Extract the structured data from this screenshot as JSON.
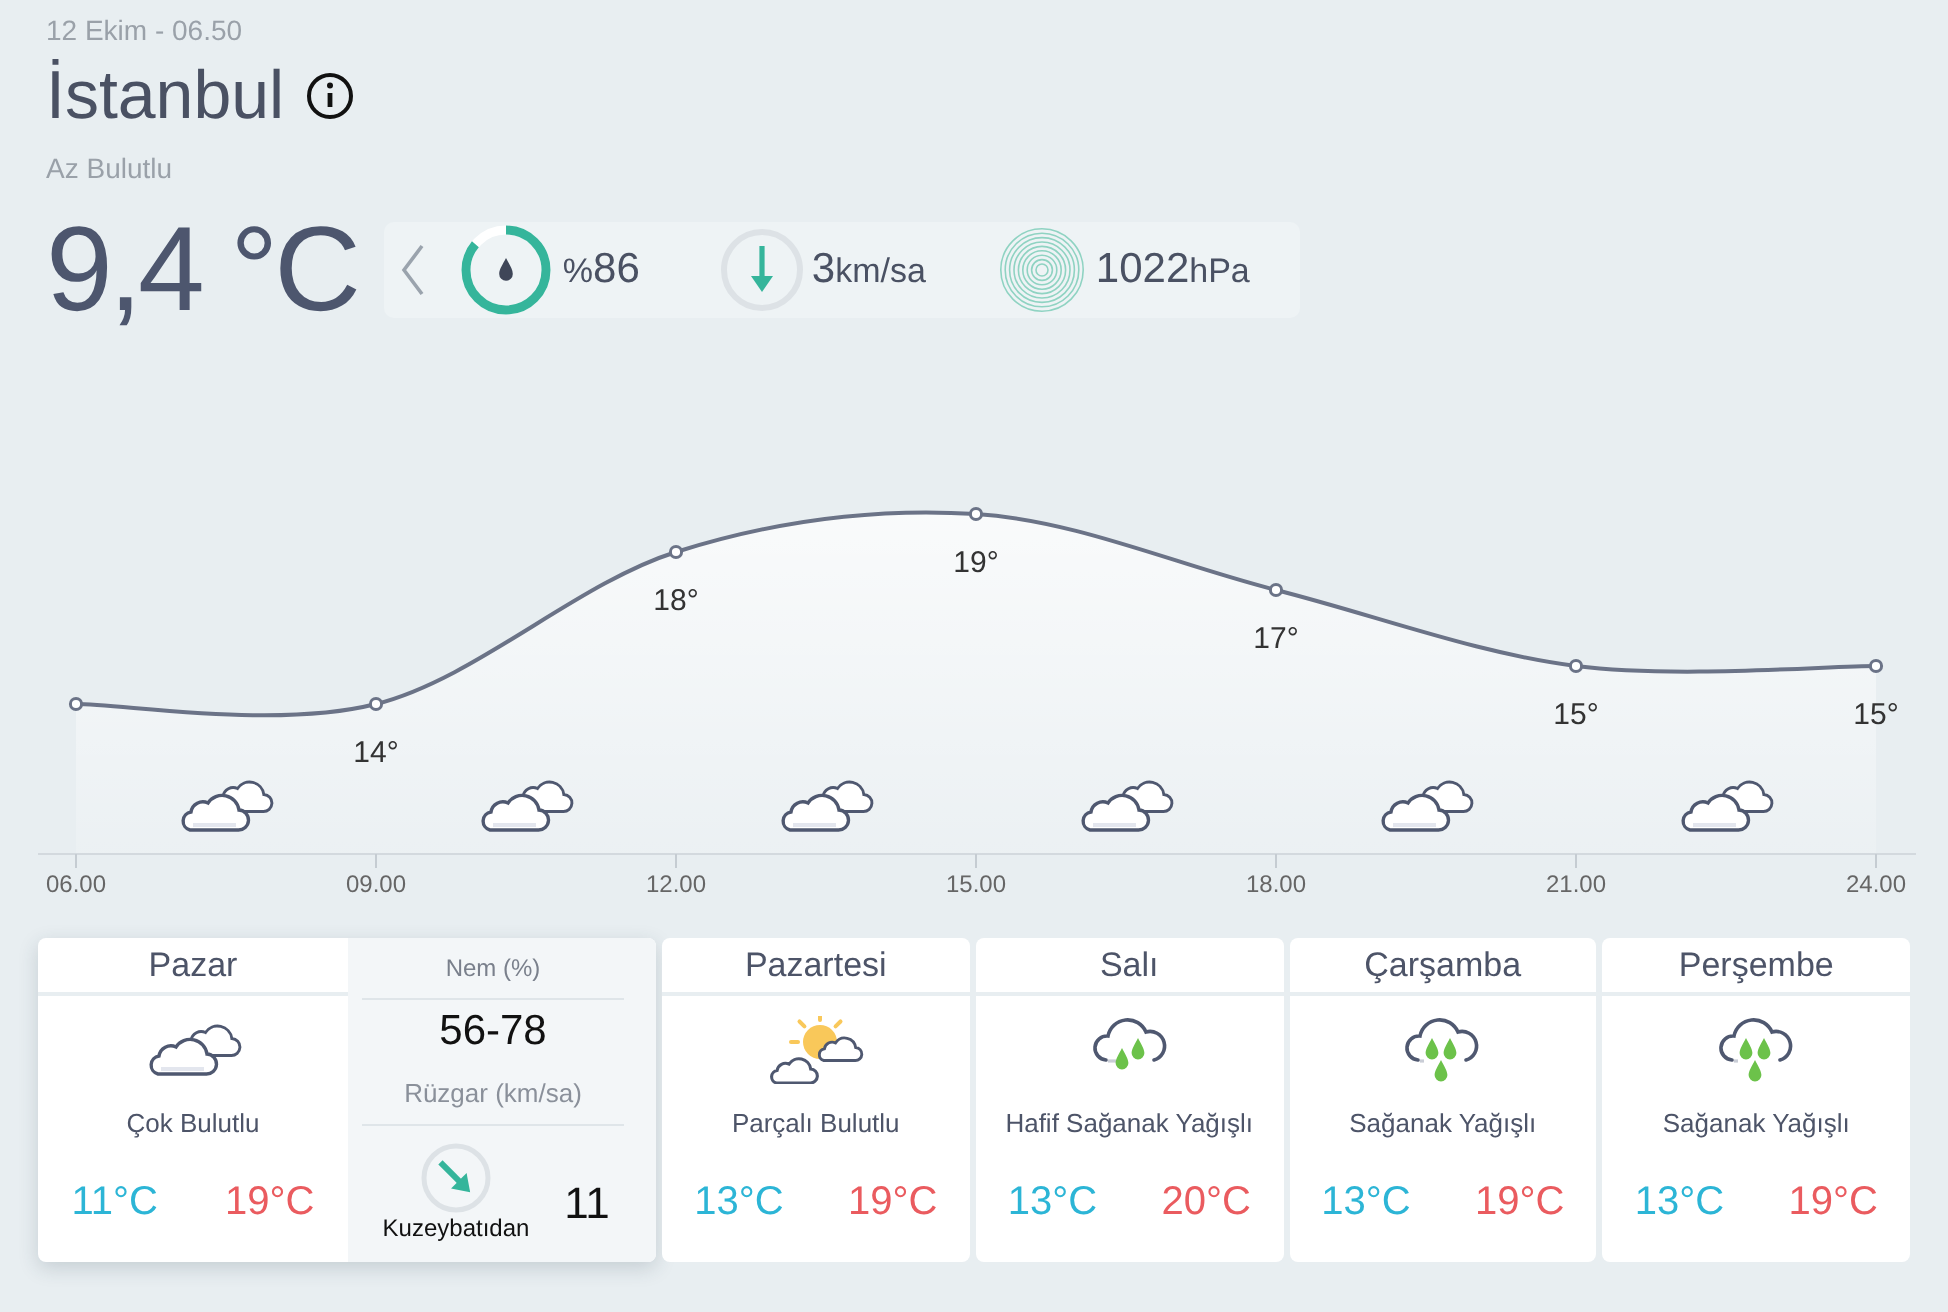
{
  "header": {
    "datetime": "12 Ekim - 06.50",
    "city": "İstanbul",
    "condition": "Az Bulutlu",
    "temperature": "9,4 °C"
  },
  "stats": {
    "humidity": {
      "unit": "%",
      "value": "86",
      "level": 0.86
    },
    "wind": {
      "value": "3",
      "unit": "km/sa"
    },
    "pressure": {
      "value": "1022",
      "unit": "hPa"
    }
  },
  "hourly": {
    "chart_data": {
      "type": "area",
      "categories": [
        "06.00",
        "09.00",
        "12.00",
        "15.00",
        "18.00",
        "21.00",
        "24.00"
      ],
      "values": [
        14,
        14,
        18,
        19,
        17,
        15,
        15
      ],
      "value_labels": [
        null,
        "14°",
        "18°",
        "19°",
        "17°",
        "15°",
        "15°"
      ]
    },
    "icons": [
      {
        "kind": "cloudy"
      },
      {
        "kind": "cloudy"
      },
      {
        "kind": "cloudy"
      },
      {
        "kind": "cloudy"
      },
      {
        "kind": "cloudy"
      },
      {
        "kind": "cloudy"
      }
    ]
  },
  "days": [
    {
      "name": "Pazar",
      "selected": true,
      "kind": "cloudy",
      "condition": "Çok Bulutlu",
      "low": "11°C",
      "high": "19°C",
      "details": {
        "humidity_label": "Nem (%)",
        "humidity": "56-78",
        "wind_label": "Rüzgar (km/sa)",
        "wind_direction": "Kuzeybatıdan",
        "wind_speed": "11"
      }
    },
    {
      "name": "Pazartesi",
      "selected": false,
      "kind": "partly-cloudy",
      "condition": "Parçalı Bulutlu",
      "low": "13°C",
      "high": "19°C"
    },
    {
      "name": "Salı",
      "selected": false,
      "kind": "light-rain",
      "condition": "Hafif Sağanak Yağışlı",
      "low": "13°C",
      "high": "20°C"
    },
    {
      "name": "Çarşamba",
      "selected": false,
      "kind": "rain",
      "condition": "Sağanak Yağışlı",
      "low": "13°C",
      "high": "19°C"
    },
    {
      "name": "Perşembe",
      "selected": false,
      "kind": "rain",
      "condition": "Sağanak Yağışlı",
      "low": "13°C",
      "high": "19°C"
    }
  ]
}
